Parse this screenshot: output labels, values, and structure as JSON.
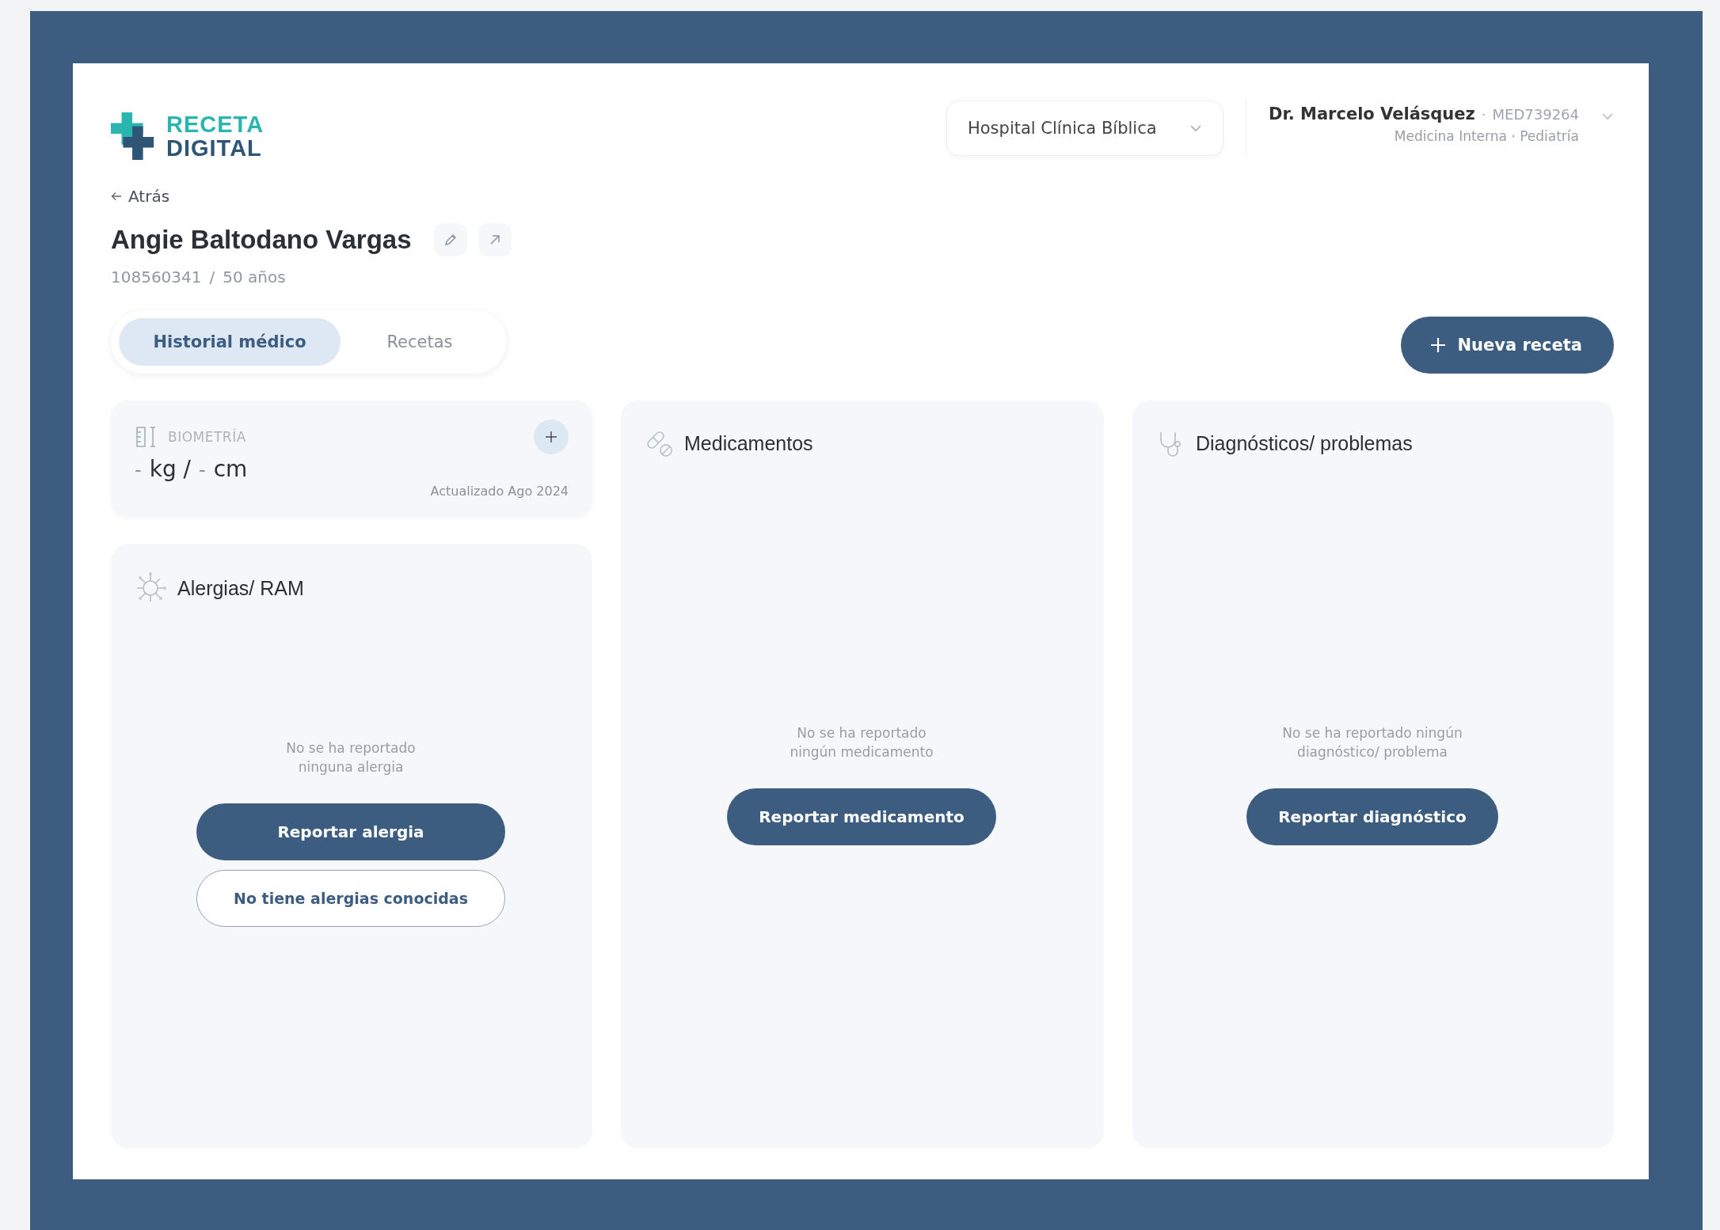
{
  "logo": {
    "line_1": "RECETA",
    "line_2": "DIGITAL"
  },
  "hospital_select": {
    "value": "Hospital Clínica Bíblica"
  },
  "doctor": {
    "name": "Dr. Marcelo Velásquez",
    "separator": "·",
    "code": "MED739264",
    "specialties": "Medicina Interna · Pediatría"
  },
  "back_link": "Atrás",
  "patient": {
    "name": "Angie Baltodano Vargas",
    "id": "108560341",
    "separator": "/",
    "age": "50 años"
  },
  "tabs": [
    {
      "label": "Historial médico",
      "selected": true
    },
    {
      "label": "Recetas",
      "selected": false
    }
  ],
  "new_button": {
    "label": "Nueva receta"
  },
  "biometry": {
    "label": "BIOMETRÍA",
    "weight": "-",
    "weight_unit": "kg /",
    "height": "-",
    "height_unit": "cm",
    "updated": "Actualizado Ago 2024"
  },
  "panels": [
    {
      "kind": "allergies",
      "title": "Alergias/ RAM",
      "empty": "No se ha reportado ninguna alergia",
      "buttons": [
        {
          "label": "Reportar alergia",
          "kind": "primary"
        },
        {
          "label": "No tiene alergias conocidas",
          "kind": "outline"
        }
      ]
    },
    {
      "kind": "medications",
      "title": "Medicamentos",
      "empty": "No se ha reportado ningún medicamento",
      "buttons": [
        {
          "label": "Reportar medicamento",
          "kind": "primary"
        }
      ]
    },
    {
      "kind": "diagnoses",
      "title": "Diagnósticos/ problemas",
      "empty": "No se ha reportado ningún diagnóstico/ problema",
      "buttons": [
        {
          "label": "Reportar diagnóstico",
          "kind": "primary"
        }
      ]
    }
  ]
}
